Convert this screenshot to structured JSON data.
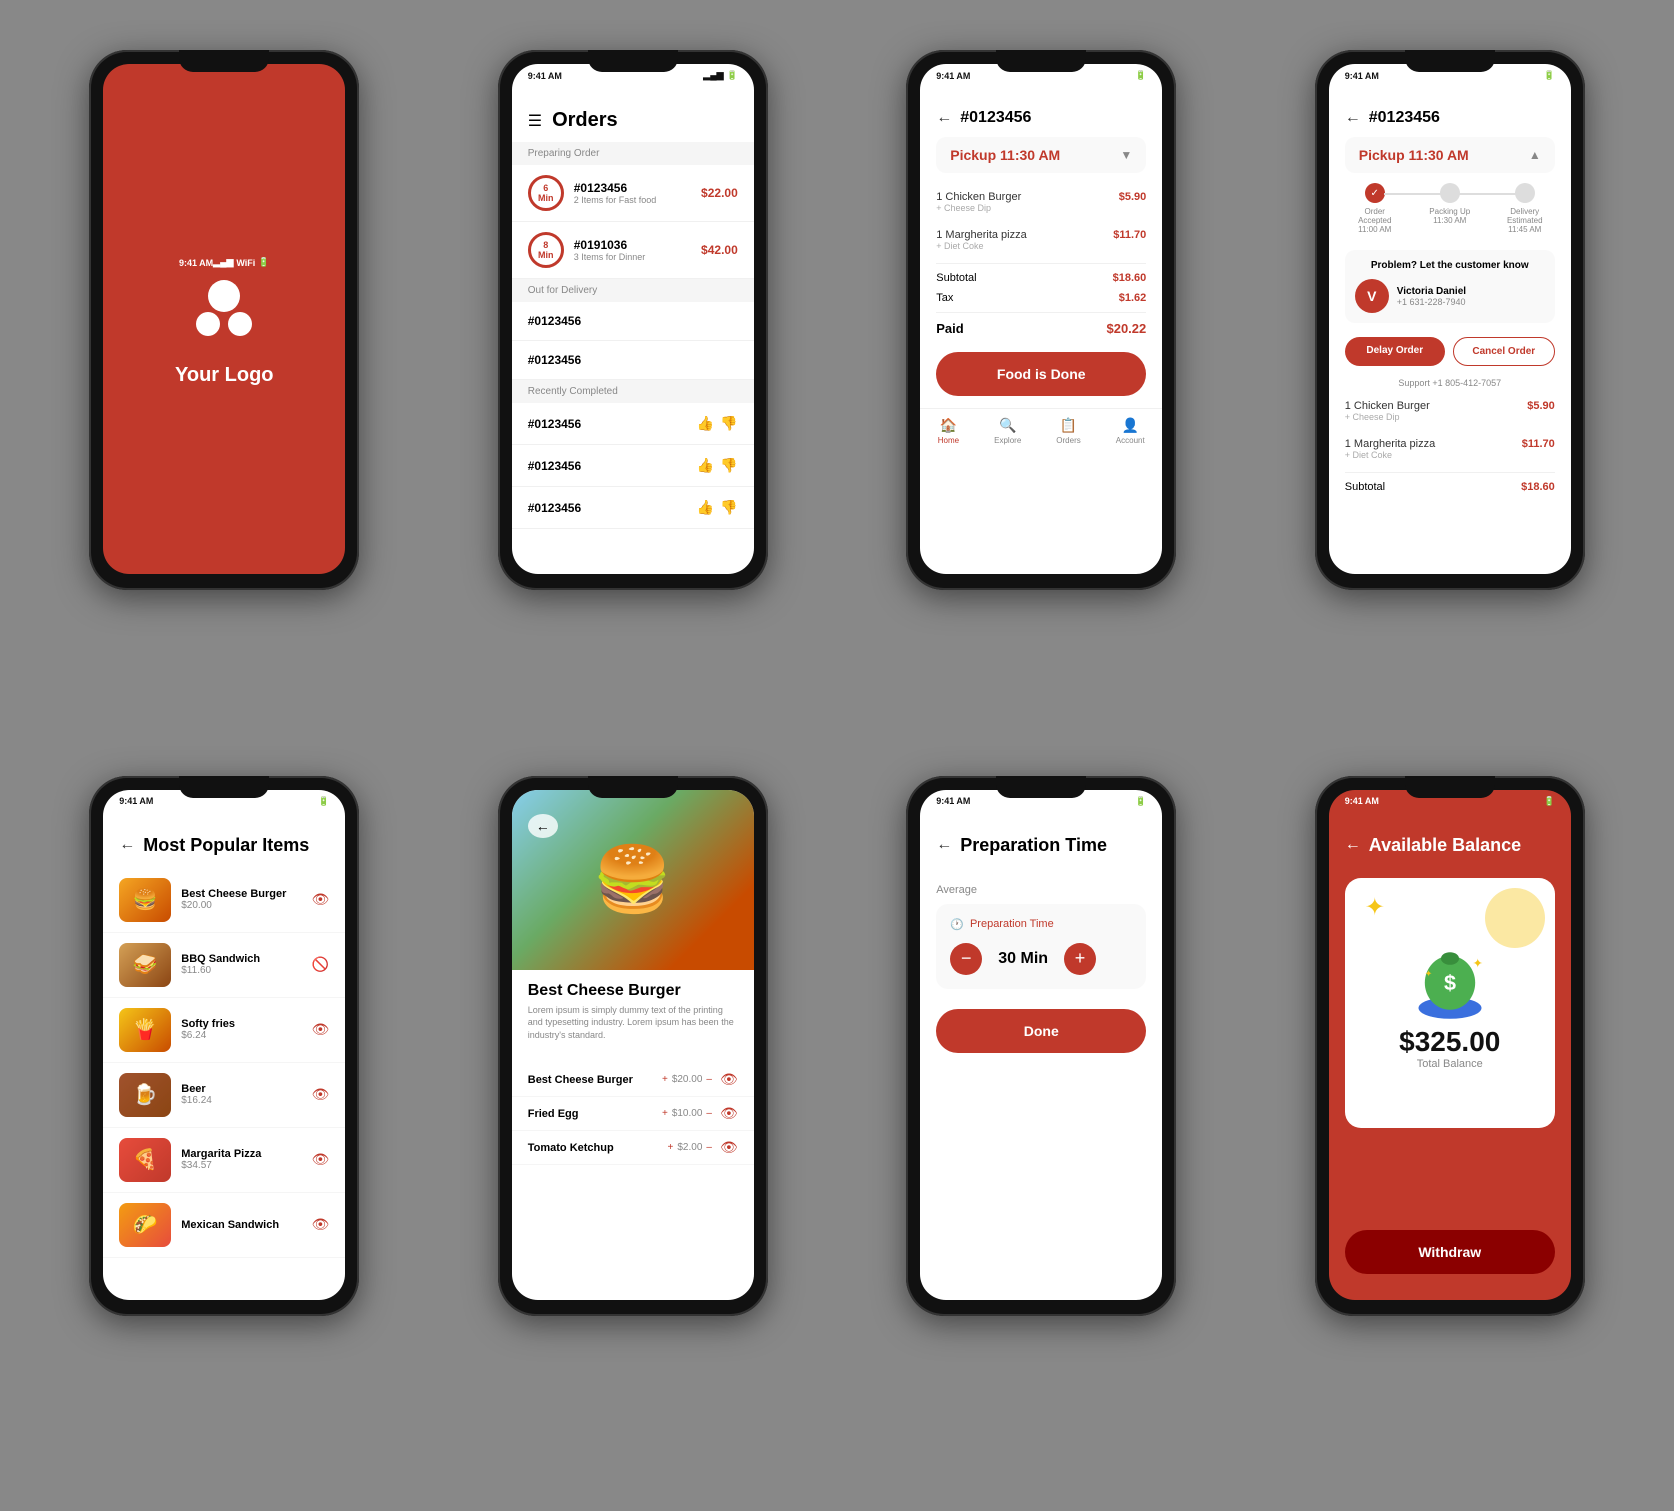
{
  "phones": {
    "splash": {
      "logo_text": "Your Logo",
      "status_time": "9:41 AM"
    },
    "orders": {
      "status_time": "9:41 AM",
      "title": "Orders",
      "section_preparing": "Preparing Order",
      "order1": {
        "timer": "6",
        "timer_unit": "Min",
        "id": "#0123456",
        "desc": "2 Items for Fast food",
        "price": "$22.00"
      },
      "order2": {
        "timer": "8",
        "timer_unit": "Min",
        "id": "#0191036",
        "desc": "3 Items for Dinner",
        "price": "$42.00"
      },
      "section_delivery": "Out for Delivery",
      "delivery1": "#0123456",
      "delivery2": "#0123456",
      "section_completed": "Recently Completed",
      "completed1": "#0123456",
      "completed2": "#0123456",
      "completed3": "#0123456"
    },
    "order_detail": {
      "status_time": "9:41 AM",
      "title": "#0123456",
      "pickup": "Pickup 11:30 AM",
      "item1_name": "1 Chicken Burger",
      "item1_sub": "+ Cheese Dip",
      "item1_price": "$5.90",
      "item2_name": "1 Margherita pizza",
      "item2_sub": "+ Diet Coke",
      "item2_price": "$11.70",
      "subtotal_label": "Subtotal",
      "subtotal_value": "$18.60",
      "tax_label": "Tax",
      "tax_value": "$1.62",
      "paid_label": "Paid",
      "paid_value": "$20.22",
      "cta_button": "Food is Done",
      "nav": [
        "Home",
        "Explore",
        "Orders",
        "Account"
      ]
    },
    "order_problem": {
      "status_time": "9:41 AM",
      "title": "#0123456",
      "pickup": "Pickup 11:30 AM",
      "track_steps": [
        {
          "label": "Order\nAccepted",
          "time": "11:00 AM",
          "active": true
        },
        {
          "label": "Packing Up",
          "time": "11:30 AM",
          "active": false
        },
        {
          "label": "Delivery\nEstimated",
          "time": "11:45 AM",
          "active": false
        }
      ],
      "problem_title": "Problem? Let the customer know",
      "customer_name": "Victoria Daniel",
      "customer_phone": "+1 631-228-7940",
      "delay_btn": "Delay Order",
      "cancel_btn": "Cancel Order",
      "support": "Support +1 805-412-7057",
      "item1_name": "1 Chicken Burger",
      "item1_sub": "+ Cheese Dip",
      "item1_price": "$5.90",
      "item2_name": "1 Margherita pizza",
      "item2_sub": "+ Diet Coke",
      "item2_price": "$11.70",
      "subtotal_label": "Subtotal",
      "subtotal_value": "$18.60"
    },
    "popular_items": {
      "status_time": "9:41 AM",
      "title": "Most Popular Items",
      "items": [
        {
          "name": "Best Cheese Burger",
          "price": "$20.00",
          "visible": true
        },
        {
          "name": "BBQ Sandwich",
          "price": "$11.60",
          "visible": false
        },
        {
          "name": "Softy fries",
          "price": "$6.24",
          "visible": true
        },
        {
          "name": "Beer",
          "price": "$16.24",
          "visible": true
        },
        {
          "name": "Margarita Pizza",
          "price": "$34.57",
          "visible": true
        },
        {
          "name": "Mexican Sandwich",
          "price": "",
          "visible": true
        }
      ]
    },
    "burger_detail": {
      "status_time": "9:41 AM",
      "name": "Best Cheese Burger",
      "desc": "Lorem ipsum is simply dummy text of the printing and typesetting industry. Lorem ipsum has been the industry's standard.",
      "addons": [
        {
          "name": "Best Cheese Burger",
          "price": "+ $20.00 –",
          "visible": true
        },
        {
          "name": "Fried Egg",
          "price": "+ $10.00 –",
          "visible": true
        },
        {
          "name": "Tomato Ketchup",
          "price": "+ $2.00 –",
          "visible": true
        }
      ]
    },
    "prep_time": {
      "status_time": "9:41 AM",
      "title": "Preparation Time",
      "avg_label": "Average",
      "box_label": "Preparation Time",
      "value": "30 Min",
      "cta_button": "Done"
    },
    "balance": {
      "status_time": "9:41 AM",
      "title": "Available Balance",
      "amount": "$325.00",
      "label": "Total Balance",
      "cta_button": "Withdraw"
    }
  }
}
